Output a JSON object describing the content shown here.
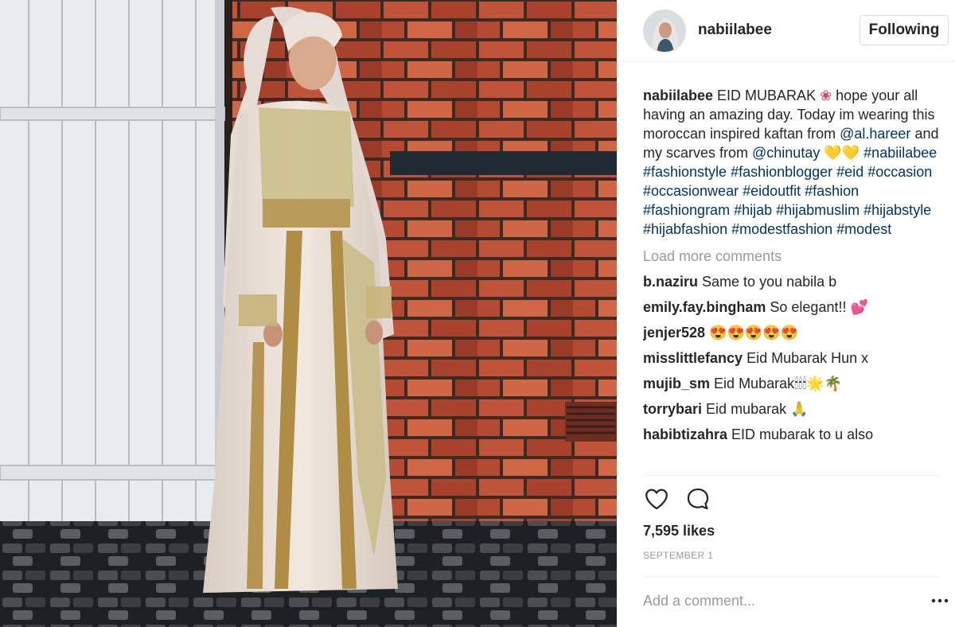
{
  "post": {
    "username": "nabiilabee",
    "follow_label": "Following",
    "caption": {
      "user": "nabiilabee",
      "text_1": "EID MUBARAK ",
      "flower": "❀",
      "text_2": " hope your all having an amazing day. Today im wearing this moroccan inspired kaftan from ",
      "mention_1": "@al.hareer",
      "text_3": " and my scarves from ",
      "mention_2": "@chinutay",
      "hearts": " 💛💛 ",
      "hashtags": "#nabiilabee #fashionstyle #fashionblogger #eid #occasion #occasionwear #eidoutfit #fashion #fashiongram #hijab #hijabmuslim #hijabstyle #hijabfashion #modestfashion #modest"
    },
    "load_more": "Load more comments",
    "comments": [
      {
        "user": "b.naziru",
        "text": "Same to you nabila b"
      },
      {
        "user": "emily.fay.bingham",
        "text": "So elegant!! 💕"
      },
      {
        "user": "jenjer528",
        "text": "😍😍😍😍😍"
      },
      {
        "user": "misslittlefancy",
        "text": "Eid Mubarak Hun x"
      },
      {
        "user": "mujib_sm",
        "text": "Eid Mubarak🕯🕯🕯🌟🌴"
      },
      {
        "user": "torrybari",
        "text": "Eid mubarak 🙏"
      },
      {
        "user": "habibtizahra",
        "text": "EID mubarak to u also"
      }
    ],
    "likes": "7,595 likes",
    "date": "SEPTEMBER 1",
    "add_comment_placeholder": "Add a comment...",
    "icons": {
      "like": "heart-icon",
      "comment": "comment-bubble-icon",
      "more": "more-options-icon"
    }
  }
}
